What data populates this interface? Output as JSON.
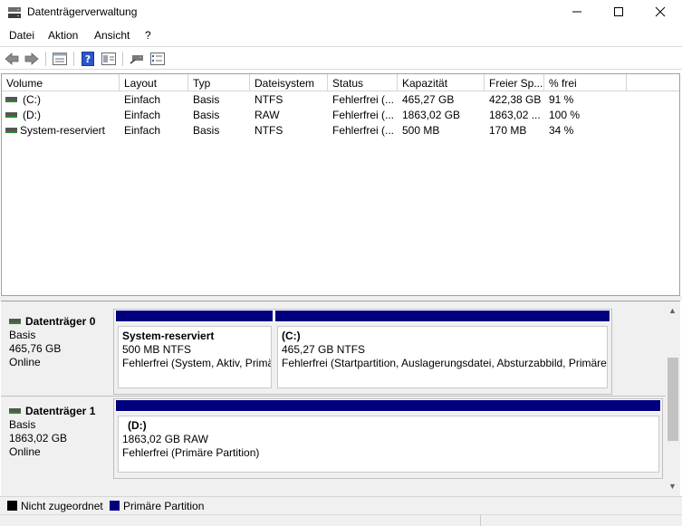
{
  "window": {
    "title": "Datenträgerverwaltung"
  },
  "menu": [
    "Datei",
    "Aktion",
    "Ansicht",
    "?"
  ],
  "toolbar": {
    "icons": [
      "back-arrow-icon",
      "forward-arrow-icon",
      "disk-list-icon",
      "help-icon",
      "properties-icon",
      "connect-icon",
      "settings-list-icon"
    ]
  },
  "volume_list": {
    "columns": [
      "Volume",
      "Layout",
      "Typ",
      "Dateisystem",
      "Status",
      "Kapazität",
      "Freier Sp...",
      "% frei"
    ],
    "rows": [
      [
        "(C:)",
        "Einfach",
        "Basis",
        "NTFS",
        "Fehlerfrei (...",
        "465,27 GB",
        "422,38 GB",
        "91 %"
      ],
      [
        "(D:)",
        "Einfach",
        "Basis",
        "RAW",
        "Fehlerfrei (...",
        "1863,02 GB",
        "1863,02 ...",
        "100 %"
      ],
      [
        "System-reserviert",
        "Einfach",
        "Basis",
        "NTFS",
        "Fehlerfrei (...",
        "500 MB",
        "170 MB",
        "34 %"
      ]
    ]
  },
  "disks": [
    {
      "name": "Datenträger 0",
      "type": "Basis",
      "size": "465,76 GB",
      "state": "Online",
      "partitions": [
        {
          "title": "System-reserviert",
          "size_fs": "500 MB NTFS",
          "status": "Fehlerfrei (System, Aktiv, Primä"
        },
        {
          "title": "(C:)",
          "size_fs": "465,27 GB NTFS",
          "status": "Fehlerfrei (Startpartition, Auslagerungsdatei, Absturzabbild, Primäre"
        }
      ]
    },
    {
      "name": "Datenträger 1",
      "type": "Basis",
      "size": "1863,02 GB",
      "state": "Online",
      "partitions": [
        {
          "title": "(D:)",
          "size_fs": "1863,02 GB RAW",
          "status": "Fehlerfrei (Primäre Partition)"
        }
      ]
    }
  ],
  "legend": [
    {
      "label": "Nicht zugeordnet",
      "color": "#000000"
    },
    {
      "label": "Primäre Partition",
      "color": "#00007f"
    }
  ],
  "colors": {
    "primary_partition": "#00007f",
    "unallocated": "#000000"
  }
}
